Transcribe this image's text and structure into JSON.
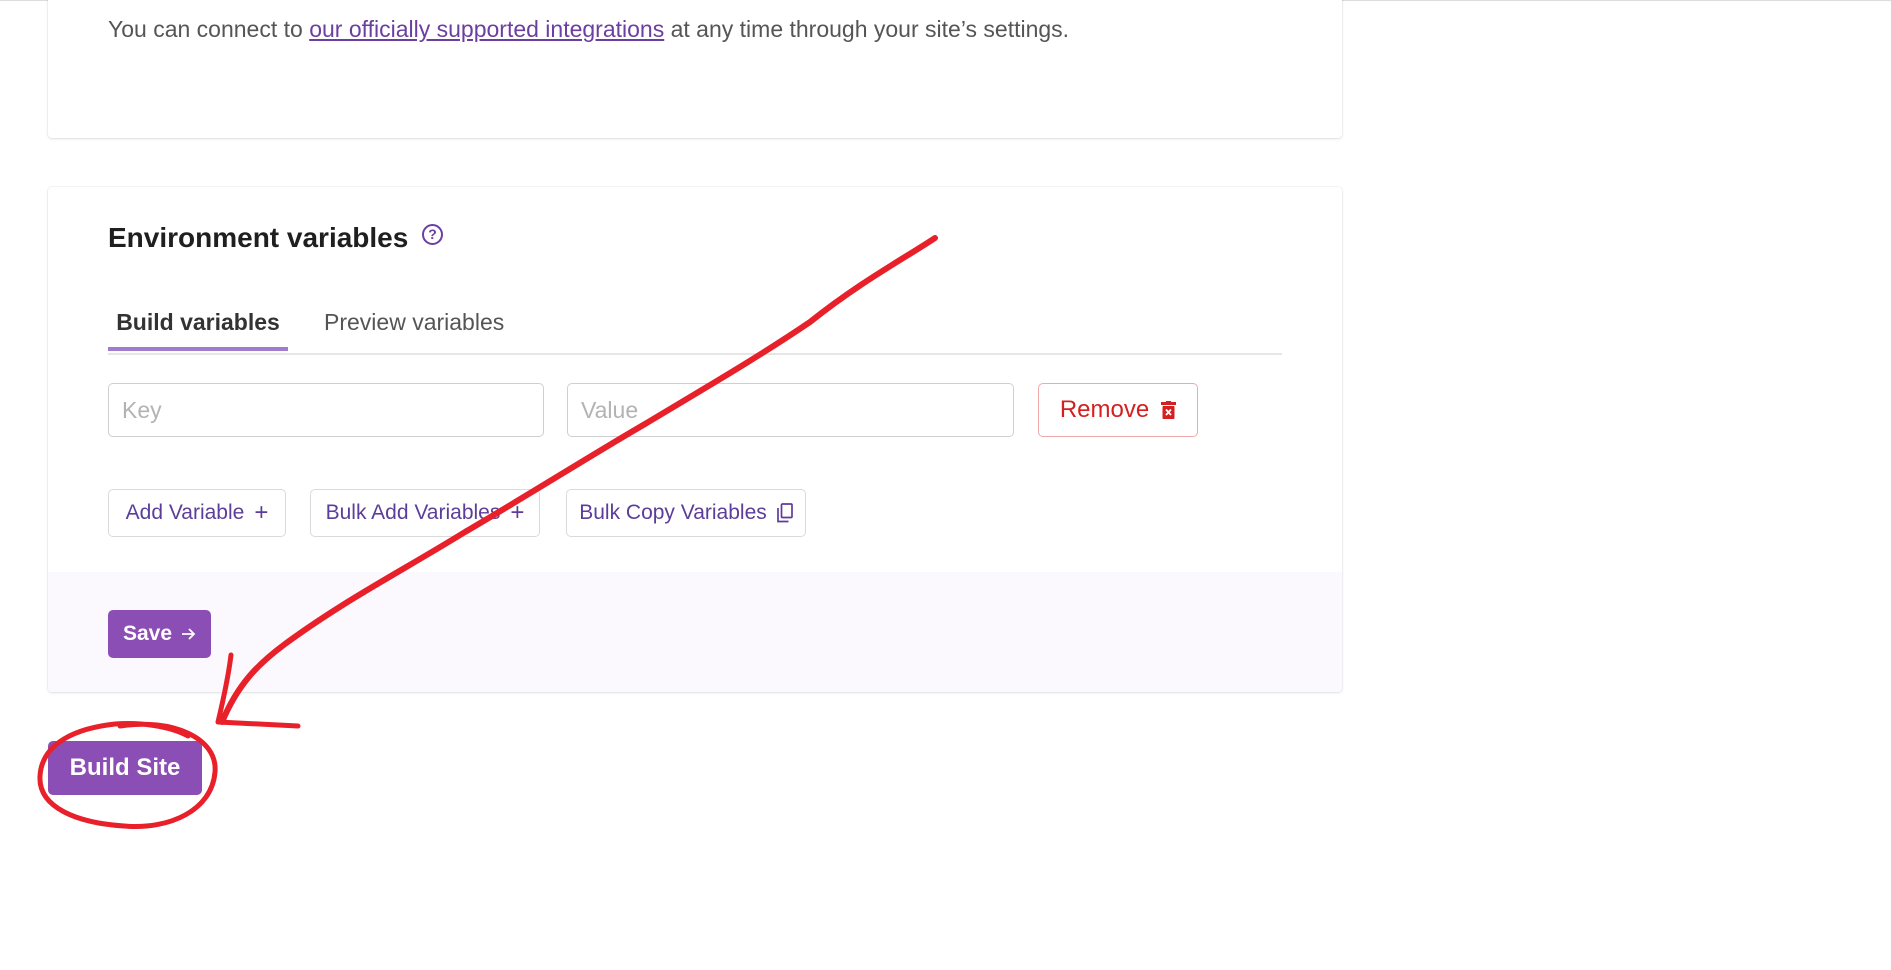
{
  "integrations": {
    "text_before": "You can connect to ",
    "link_text": "our officially supported integrations",
    "text_after": " at any time through your site’s settings."
  },
  "env": {
    "title": "Environment variables",
    "help_icon": "question-circle-icon",
    "tabs": [
      {
        "label": "Build variables",
        "active": true
      },
      {
        "label": "Preview variables",
        "active": false
      }
    ],
    "key_placeholder": "Key",
    "value_placeholder": "Value",
    "remove_label": "Remove",
    "add_variable_label": "Add Variable",
    "bulk_add_label": "Bulk Add Variables",
    "bulk_copy_label": "Bulk Copy Variables",
    "save_label": "Save"
  },
  "build_label": "Build Site",
  "colors": {
    "accent": "#8a4eb4",
    "link": "#6b3fa0",
    "remove": "#d42020",
    "annotation": "#e8202a"
  }
}
